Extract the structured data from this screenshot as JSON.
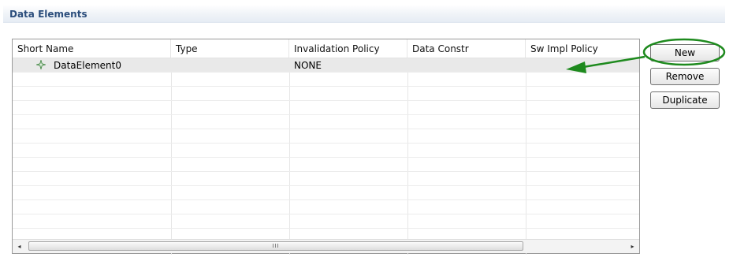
{
  "section": {
    "title": "Data Elements"
  },
  "table": {
    "columns": [
      "Short Name",
      "Type",
      "Invalidation Policy",
      "Data Constr",
      "Sw Impl Policy"
    ],
    "rows": [
      {
        "short_name": "DataElement0",
        "type": "",
        "invalidation_policy": "NONE",
        "data_constr": "",
        "sw_impl_policy": "",
        "selected": true
      }
    ],
    "scrollbar": {
      "left_arrow": "◂",
      "right_arrow": "▸",
      "thumb_grip": "III"
    }
  },
  "buttons": {
    "new": "New",
    "remove": "Remove",
    "duplicate": "Duplicate"
  },
  "annotation": {
    "color": "#1e8a1e",
    "highlight": "new-button"
  },
  "icons": {
    "row_icon": "data-element-icon"
  }
}
